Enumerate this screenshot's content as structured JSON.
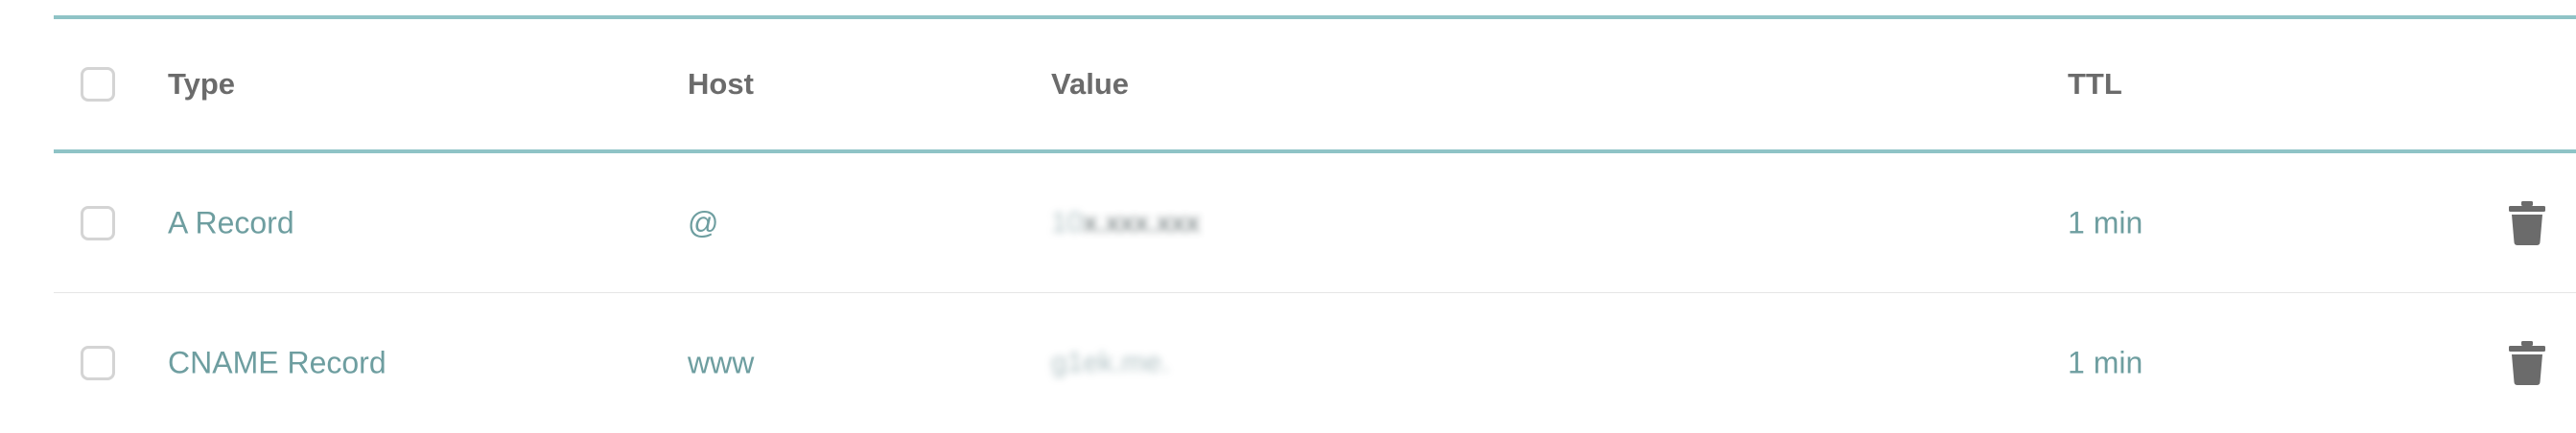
{
  "table": {
    "columns": {
      "type": "Type",
      "host": "Host",
      "value": "Value",
      "ttl": "TTL"
    },
    "rows": [
      {
        "type": "A Record",
        "host": "@",
        "value_part1": "10",
        "value_part2": "x.xxx.xxx",
        "ttl": "1 min"
      },
      {
        "type": "CNAME Record",
        "host": "www",
        "value": "g1ek.me.",
        "ttl": "1 min"
      }
    ]
  },
  "icons": {
    "row_delete": "trash-icon",
    "select": "checkbox-icon"
  },
  "colors": {
    "accent_border": "#8fc3c6",
    "header_text": "#6b6b6b",
    "cell_text": "#6e9ea0",
    "trash": "#6b6b6b"
  }
}
